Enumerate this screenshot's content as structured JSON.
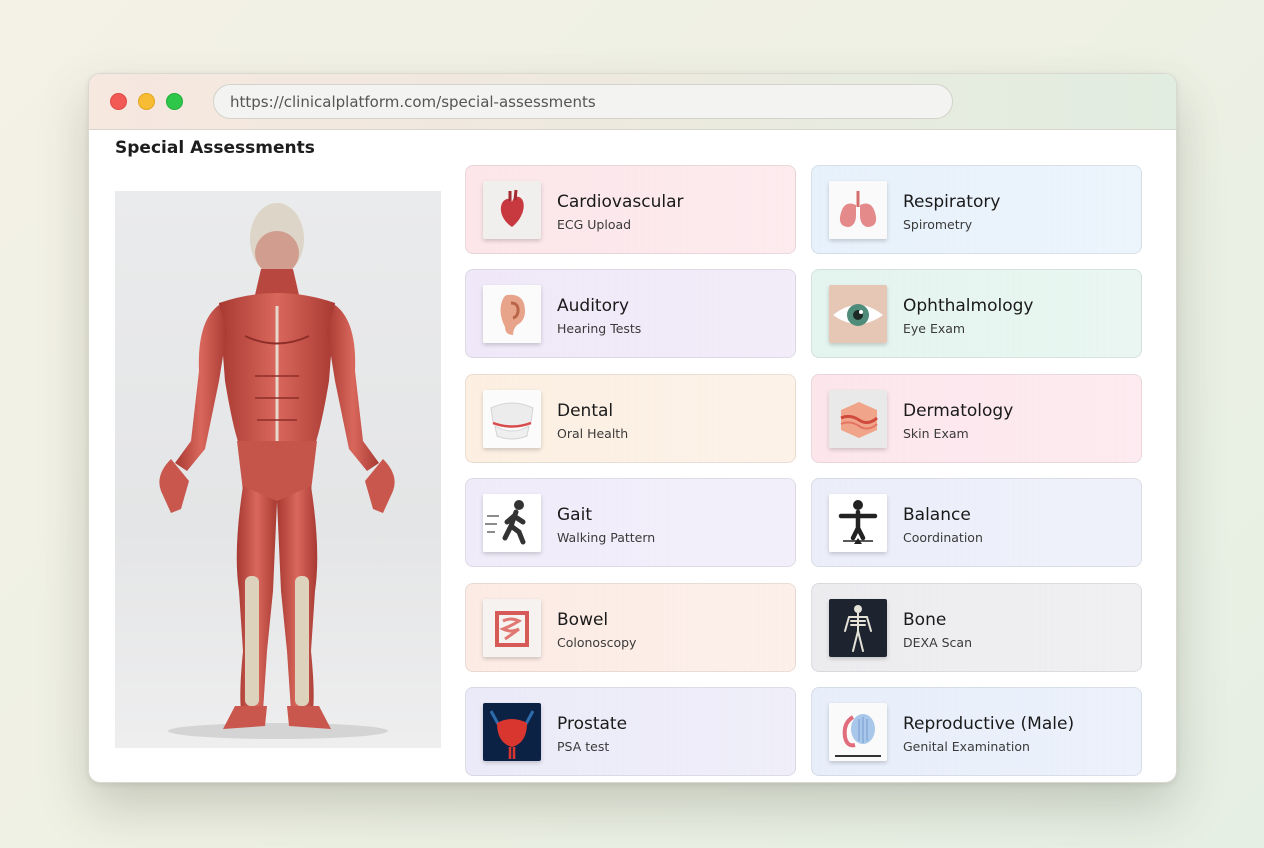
{
  "browser": {
    "url": "https://clinicalplatform.com/special-assessments"
  },
  "page": {
    "title": "Special Assessments"
  },
  "cards": [
    {
      "title": "Cardiovascular",
      "subtitle": "ECG Upload",
      "icon": "heart-icon",
      "bg": "#fce6ea"
    },
    {
      "title": "Respiratory",
      "subtitle": "Spirometry",
      "icon": "lungs-icon",
      "bg": "#e7f1fb"
    },
    {
      "title": "Auditory",
      "subtitle": "Hearing Tests",
      "icon": "ear-icon",
      "bg": "#efe8f8"
    },
    {
      "title": "Ophthalmology",
      "subtitle": "Eye Exam",
      "icon": "eye-icon",
      "bg": "#e4f4ee"
    },
    {
      "title": "Dental",
      "subtitle": "Oral Health",
      "icon": "teeth-icon",
      "bg": "#fcefe2"
    },
    {
      "title": "Dermatology",
      "subtitle": "Skin Exam",
      "icon": "skin-icon",
      "bg": "#fce6ec"
    },
    {
      "title": "Gait",
      "subtitle": "Walking Pattern",
      "icon": "walking-person-icon",
      "bg": "#f0ebf9"
    },
    {
      "title": "Balance",
      "subtitle": "Coordination",
      "icon": "balance-person-icon",
      "bg": "#ebedf9"
    },
    {
      "title": "Bowel",
      "subtitle": "Colonoscopy",
      "icon": "intestine-icon",
      "bg": "#fcebe4"
    },
    {
      "title": "Bone",
      "subtitle": "DEXA Scan",
      "icon": "skeleton-icon",
      "bg": "#ececef"
    },
    {
      "title": "Prostate",
      "subtitle": "PSA test",
      "icon": "prostate-icon",
      "bg": "#ebeaf8"
    },
    {
      "title": "Reproductive (Male)",
      "subtitle": "Genital Examination",
      "icon": "reproductive-icon",
      "bg": "#e7eefa"
    }
  ]
}
